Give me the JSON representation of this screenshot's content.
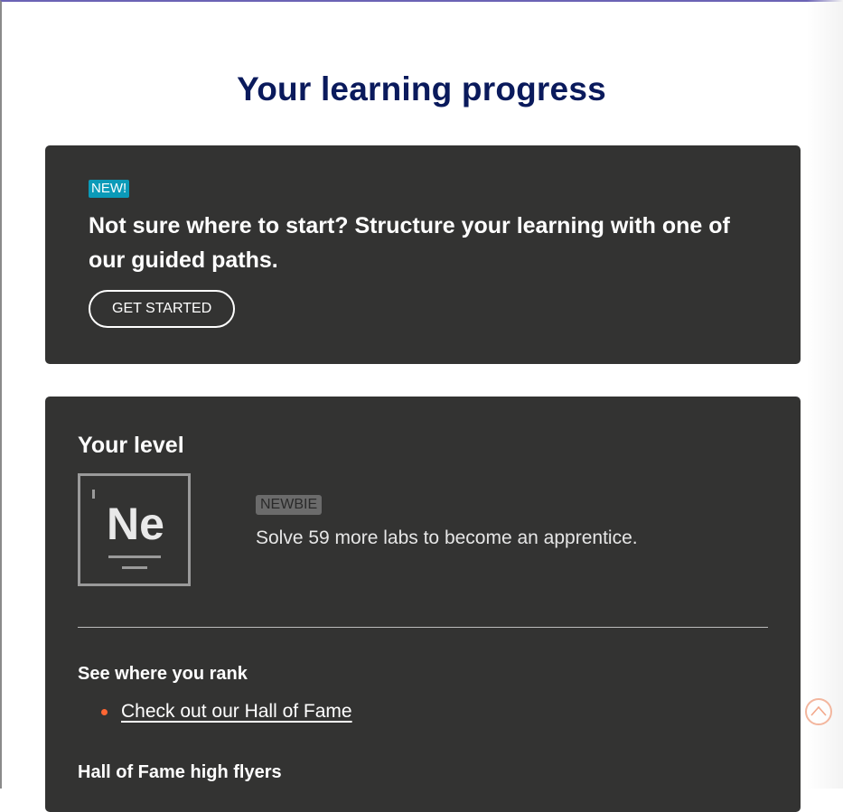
{
  "page": {
    "title": "Your learning progress"
  },
  "guided": {
    "badge": "NEW!",
    "heading": "Not sure where to start? Structure your learning with one of our guided paths.",
    "button_label": "GET STARTED"
  },
  "level": {
    "heading": "Your level",
    "element_symbol": "Ne",
    "badge": "NEWBIE",
    "description": "Solve 59 more labs to become an apprentice."
  },
  "rank": {
    "heading": "See where you rank",
    "link_label": "Check out our Hall of Fame"
  },
  "flyers": {
    "heading": "Hall of Fame high flyers"
  },
  "colors": {
    "title": "#0a1a5c",
    "card_bg": "#333332",
    "new_badge": "#0b9ab8",
    "bullet": "#ff6633"
  },
  "icons": {
    "scroll_top": "chevron-up-icon"
  }
}
